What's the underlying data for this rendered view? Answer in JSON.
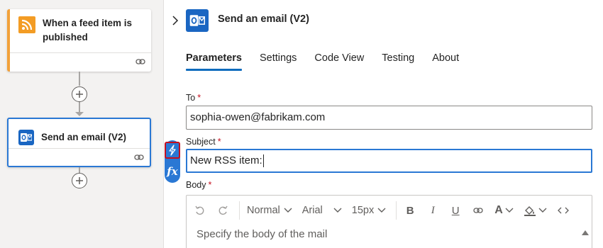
{
  "canvas": {
    "trigger_title": "When a feed item is published",
    "action_title": "Send an email (V2)"
  },
  "panel": {
    "title": "Send an email (V2)",
    "tabs": [
      {
        "label": "Parameters",
        "active": true
      },
      {
        "label": "Settings"
      },
      {
        "label": "Code View"
      },
      {
        "label": "Testing"
      },
      {
        "label": "About"
      }
    ],
    "fields": {
      "to": {
        "label": "To",
        "required_mark": "*",
        "value": "sophia-owen@fabrikam.com"
      },
      "subject": {
        "label": "Subject",
        "required_mark": "*",
        "value": "New RSS item:"
      },
      "body": {
        "label": "Body",
        "required_mark": "*",
        "placeholder": "Specify the body of the mail"
      }
    },
    "toolbar": {
      "style": "Normal",
      "font": "Arial",
      "size": "15px"
    },
    "side_tools": {
      "dynamic_content": "lightning-icon",
      "expression": "fx"
    }
  },
  "colors": {
    "accent": "#2a78d4",
    "trigger_accent": "#f2a13a",
    "outlook": "#1a66c2",
    "required": "#c50f1f"
  }
}
